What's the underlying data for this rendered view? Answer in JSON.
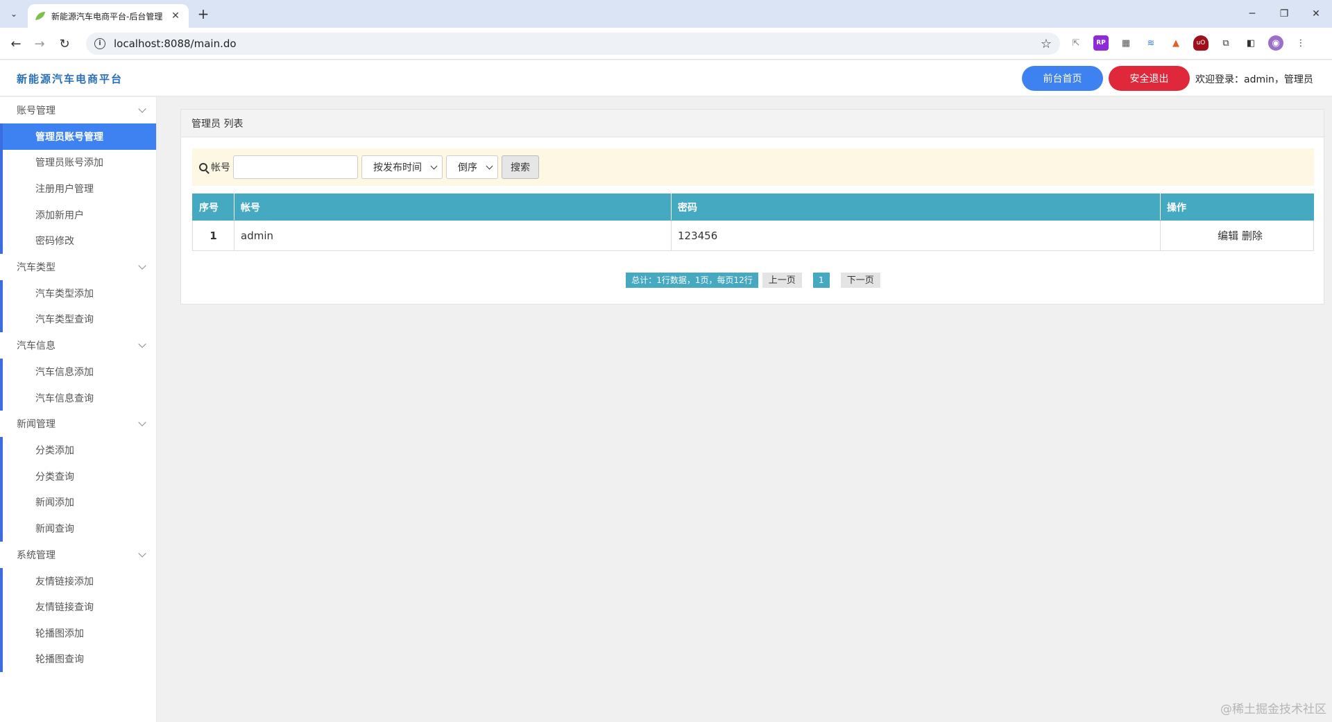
{
  "browser": {
    "tab_title": "新能源汽车电商平台-后台管理",
    "url": "localhost:8088/main.do",
    "new_tab": "+",
    "close": "✕"
  },
  "header": {
    "brand": "新能源汽车电商平台",
    "front_button": "前台首页",
    "logout_button": "安全退出",
    "welcome": "欢迎登录：admin，管理员"
  },
  "sidebar": {
    "groups": [
      {
        "title": "账号管理",
        "items": [
          "管理员账号管理",
          "管理员账号添加",
          "注册用户管理",
          "添加新用户",
          "密码修改"
        ]
      },
      {
        "title": "汽车类型",
        "items": [
          "汽车类型添加",
          "汽车类型查询"
        ]
      },
      {
        "title": "汽车信息",
        "items": [
          "汽车信息添加",
          "汽车信息查询"
        ]
      },
      {
        "title": "新闻管理",
        "items": [
          "分类添加",
          "分类查询",
          "新闻添加",
          "新闻查询"
        ]
      },
      {
        "title": "系统管理",
        "items": [
          "友情链接添加",
          "友情链接查询",
          "轮播图添加",
          "轮播图查询"
        ]
      }
    ],
    "active_item": "管理员账号管理"
  },
  "panel": {
    "title": "管理员 列表",
    "search": {
      "label": "帐号",
      "value": "",
      "sort_field": "按发布时间",
      "sort_order": "倒序",
      "button": "搜索"
    },
    "table": {
      "columns": [
        "序号",
        "帐号",
        "密码",
        "操作"
      ],
      "rows": [
        {
          "idx": "1",
          "account": "admin",
          "password": "123456",
          "edit": "编辑",
          "delete": "删除"
        }
      ]
    },
    "pager": {
      "summary": "总计：1行数据，1页，每页12行",
      "prev": "上一页",
      "page": "1",
      "next": "下一页"
    }
  },
  "watermark": "@稀土掘金技术社区"
}
